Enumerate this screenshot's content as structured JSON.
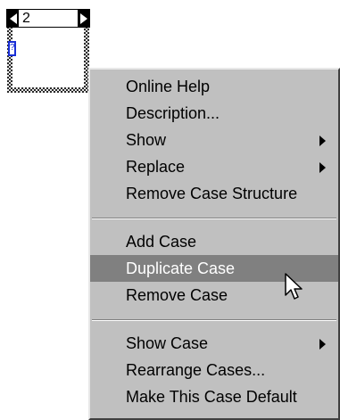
{
  "case_structure": {
    "selector_value": "2",
    "terminal_glyph": "?"
  },
  "context_menu": {
    "groups": [
      {
        "items": [
          {
            "label": "Online Help",
            "submenu": false,
            "highlighted": false
          },
          {
            "label": "Description...",
            "submenu": false,
            "highlighted": false
          },
          {
            "label": "Show",
            "submenu": true,
            "highlighted": false
          },
          {
            "label": "Replace",
            "submenu": true,
            "highlighted": false
          },
          {
            "label": "Remove Case Structure",
            "submenu": false,
            "highlighted": false
          }
        ]
      },
      {
        "items": [
          {
            "label": "Add Case",
            "submenu": false,
            "highlighted": false
          },
          {
            "label": "Duplicate Case",
            "submenu": false,
            "highlighted": true
          },
          {
            "label": "Remove Case",
            "submenu": false,
            "highlighted": false
          }
        ]
      },
      {
        "items": [
          {
            "label": "Show Case",
            "submenu": true,
            "highlighted": false
          },
          {
            "label": "Rearrange Cases...",
            "submenu": false,
            "highlighted": false
          },
          {
            "label": "Make This Case Default",
            "submenu": false,
            "highlighted": false
          }
        ]
      }
    ]
  },
  "colors": {
    "menu_background": "#c0c0c0",
    "highlight": "#808080",
    "highlight_text": "#ffffff",
    "terminal_blue": "#1a2fd6"
  }
}
